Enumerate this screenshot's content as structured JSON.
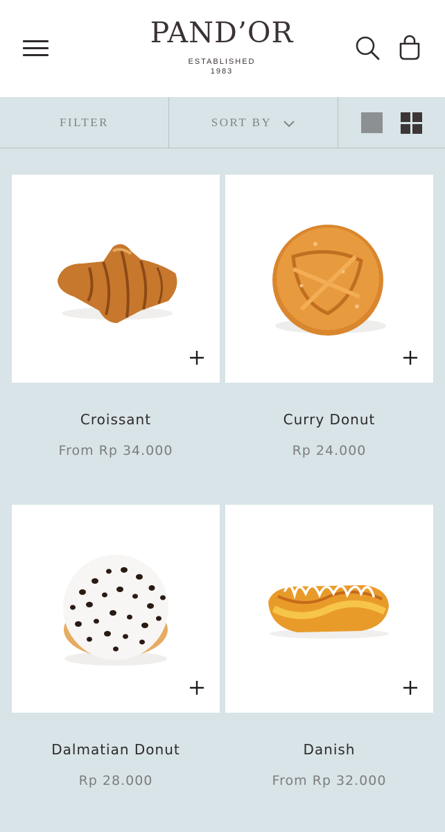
{
  "header": {
    "brand": "PAND’OR",
    "tagline": "ESTABLISHED",
    "year": "1983",
    "menu_icon": "hamburger-menu-icon",
    "search_icon": "search-icon",
    "cart_icon": "shopping-bag-icon"
  },
  "toolbar": {
    "filter_label": "FILTER",
    "sort_label": "SORT BY",
    "sort_icon": "chevron-down-icon",
    "view_single_icon": "single-column-view-icon",
    "view_grid_icon": "grid-view-icon"
  },
  "products": [
    {
      "name": "Croissant",
      "price": "From Rp 34.000",
      "image": "croissant"
    },
    {
      "name": "Curry Donut",
      "price": "Rp 24.000",
      "image": "curry-donut"
    },
    {
      "name": "Dalmatian Donut",
      "price": "Rp 28.000",
      "image": "dalmatian-donut"
    },
    {
      "name": "Danish",
      "price": "From Rp 32.000",
      "image": "danish"
    }
  ],
  "colors": {
    "page_background": "#d8e4e7",
    "card_background": "#ffffff",
    "text": "#2d2a2b",
    "muted_text": "#7d7d7d"
  }
}
